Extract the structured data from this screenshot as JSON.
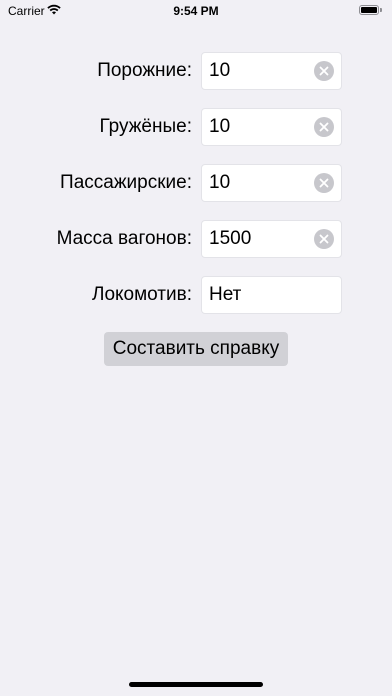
{
  "status_bar": {
    "carrier": "Carrier",
    "time": "9:54 PM",
    "wifi_icon": "wifi-icon",
    "battery_icon": "battery-icon"
  },
  "form": {
    "rows": [
      {
        "label": "Порожние:",
        "value": "10",
        "has_clear": true
      },
      {
        "label": "Гружёные:",
        "value": "10",
        "has_clear": true
      },
      {
        "label": "Пассажирские:",
        "value": "10",
        "has_clear": true
      },
      {
        "label": "Масса вагонов:",
        "value": "1500",
        "has_clear": true
      },
      {
        "label": "Локомотив:",
        "value": "Нет",
        "has_clear": false
      }
    ],
    "submit_label": "Составить справку"
  },
  "colors": {
    "background": "#f1f0f5",
    "field_background": "#ffffff",
    "button_background": "#d1d1d6",
    "clear_icon": "#c7c7cc"
  }
}
